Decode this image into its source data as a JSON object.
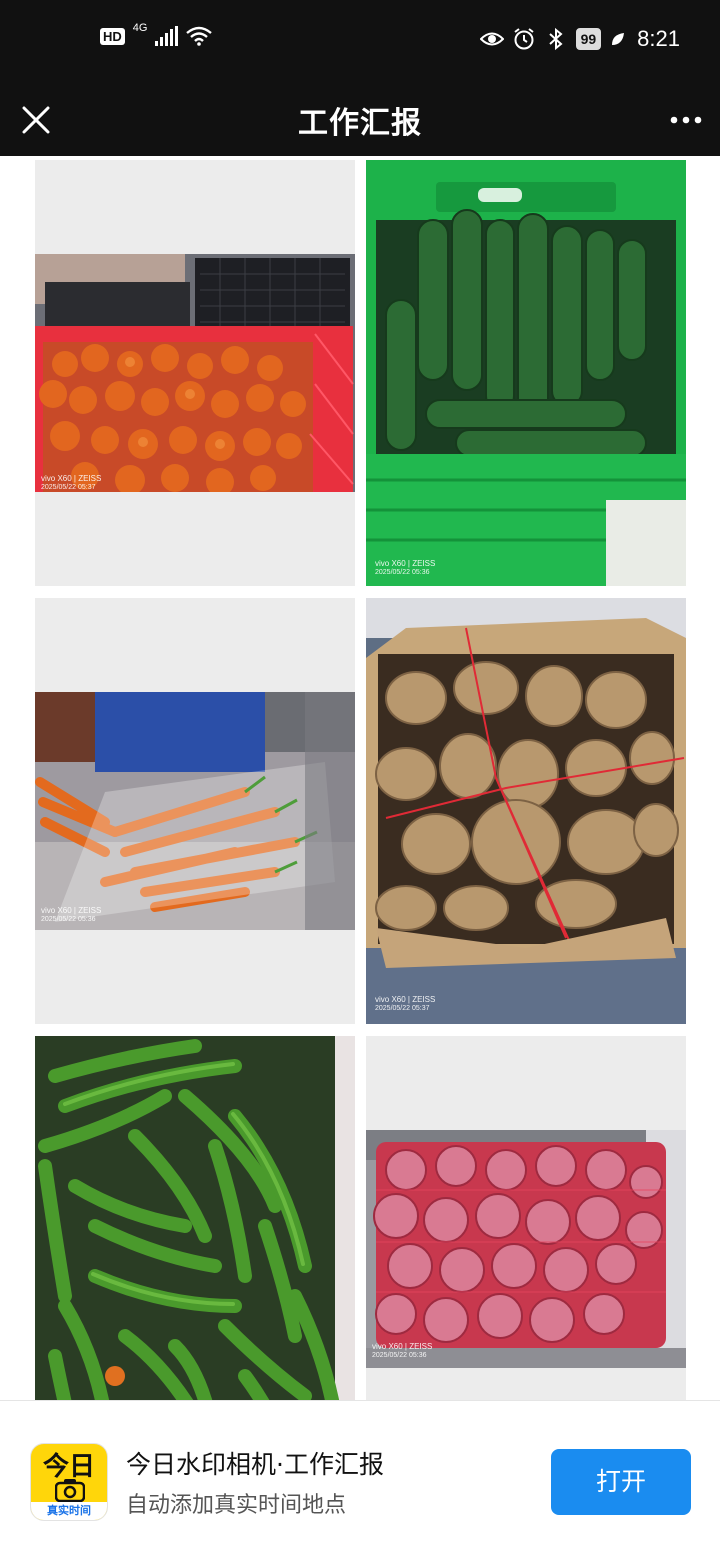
{
  "status_bar": {
    "hd": "HD",
    "network": "4G",
    "battery": "99",
    "time": "8:21"
  },
  "nav": {
    "title": "工作汇报",
    "close_icon": "close-icon",
    "more_icon": "more-dots-icon"
  },
  "photos": [
    {
      "subject": "tomatoes",
      "wm_brand": "vivo X60 | ZEISS",
      "wm_time": "2025/05/22 05:37"
    },
    {
      "subject": "cucumbers",
      "wm_brand": "vivo X60 | ZEISS",
      "wm_time": "2025/05/22 05:36"
    },
    {
      "subject": "carrots",
      "wm_brand": "vivo X60 | ZEISS",
      "wm_time": "2025/05/22 05:36"
    },
    {
      "subject": "potatoes",
      "wm_brand": "vivo X60 | ZEISS",
      "wm_time": "2025/05/22 05:37"
    },
    {
      "subject": "green-peppers",
      "wm_brand": "",
      "wm_time": ""
    },
    {
      "subject": "red-onions",
      "wm_brand": "vivo X60 | ZEISS",
      "wm_time": "2025/05/22 05:36"
    }
  ],
  "banner": {
    "logo_top": "今日",
    "logo_bottom": "真实时间",
    "title": "今日水印相机·工作汇报",
    "subtitle": "自动添加真实时间地点",
    "open_button": "打开"
  },
  "colors": {
    "status_bg": "#111111",
    "accent_blue": "#1a8cf0",
    "logo_yellow": "#ffd60a"
  }
}
